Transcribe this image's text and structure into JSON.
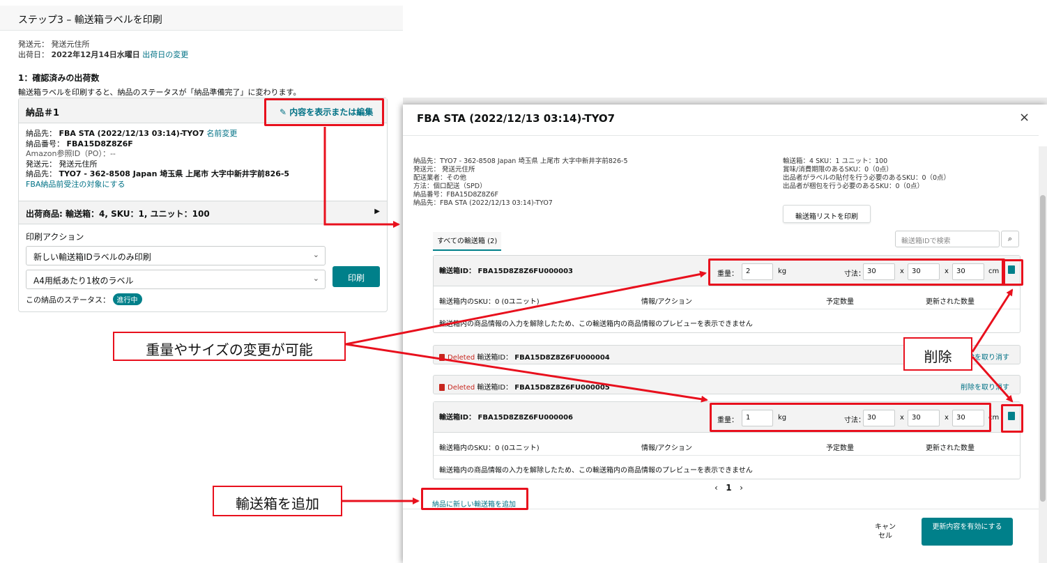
{
  "left": {
    "step_title": "ステップ3 – 輸送箱ラベルを印刷",
    "ship_from_label": "発送元：",
    "ship_from_value": "発送元住所",
    "ship_date_label": "出荷日：",
    "ship_date_value": "2022年12月14日水曜日",
    "ship_date_link": "出荷日の変更",
    "section_title": "1：確認済みの出荷数",
    "section_desc": "輸送箱ラベルを印刷すると、納品のステータスが「納品準備完了」に変わります。",
    "card": {
      "title": "納品＃1",
      "edit_link": "内容を表示または編集",
      "dest_label": "納品先：",
      "dest_value": "FBA STA (2022/12/13 03:14)-TYO7",
      "rename_link": "名前変更",
      "number_label": "納品番号：",
      "number_value": "FBA15D8Z8Z6F",
      "po_line": "Amazon参照ID（PO）：--",
      "from_label": "発送元：",
      "from_value": "発送元住所",
      "to_label": "納品先：",
      "to_value": "TYO7 - 362-8508 Japan 埼玉県 上尾市 大字中新井字前826-5",
      "prep_link": "FBA納品前受注の対象にする",
      "ship_items": "出荷商品: 輸送箱：4, SKU：1, ユニット：100",
      "print_action_label": "印刷アクション",
      "select1": "新しい輸送箱IDラベルのみ印刷",
      "select2": "A4用紙あたり1枚のラベル",
      "print_button": "印刷",
      "status_label": "この納品のステータス：",
      "status_badge": "進行中"
    }
  },
  "modal": {
    "title": "FBA STA (2022/12/13 03:14)-TYO7",
    "info_left": [
      "納品先：TYO7 - 362-8508 Japan 埼玉県 上尾市 大字中新井字前826-5",
      "発送元： 発送元住所",
      "配送業者：その他",
      "方法：個口配送（SPD）",
      "納品番号：FBA15D8Z8Z6F",
      "納品先：FBA STA (2022/12/13 03:14)-TYO7"
    ],
    "info_right": [
      "輸送箱：4  SKU：1  ユニット：100",
      "賞味/消費期限のあるSKU：0（0点）",
      "出品者がラベルの貼付を行う必要のあるSKU：0（0点）",
      "出品者が梱包を行う必要のあるSKU：0（0点）"
    ],
    "print_list_button": "輸送箱リストを印刷",
    "tab_all": "すべての輸送箱 (2)",
    "search_placeholder": "輸送箱IDで検索",
    "box1": {
      "id_label": "輸送箱ID：",
      "id": "FBA15D8Z8Z6FU000003",
      "weight_label": "重量：",
      "weight": "2",
      "weight_unit": "kg",
      "dims_label": "寸法：",
      "dim1": "30",
      "dim2": "30",
      "dim3": "30",
      "x1": "x",
      "x2": "x",
      "dims_unit": "cm"
    },
    "box2": {
      "id_label": "輸送箱ID：",
      "id": "FBA15D8Z8Z6FU000006",
      "weight_label": "重量：",
      "weight": "1",
      "weight_unit": "kg",
      "dims_label": "寸法：",
      "dim1": "30",
      "dim2": "30",
      "dim3": "30",
      "x1": "x",
      "x2": "x",
      "dims_unit": "cm"
    },
    "col_headers": [
      "輸送箱内のSKU：0 (0ユニット)",
      "情報/アクション",
      "予定数量",
      "更新された数量"
    ],
    "empty_msg": "輸送箱内の商品情報の入力を解除したため、この輸送箱内の商品情報のプレビューを表示できません",
    "deleted1": {
      "tag": "Deleted",
      "label": "輸送箱ID：",
      "id": "FBA15D8Z8Z6FU000004",
      "undo": "削除を取り消す"
    },
    "deleted2": {
      "tag": "Deleted",
      "label": "輸送箱ID：",
      "id": "FBA15D8Z8Z6FU000005",
      "undo": "削除を取り消す"
    },
    "pager": {
      "prev": "‹",
      "page": "1",
      "next": "›"
    },
    "add_box_link": "納品に新しい輸送箱を追加",
    "cancel_label": "キャンセル",
    "submit_label": "更新内容を有効にする"
  },
  "annotations": {
    "callout_resize": "重量やサイズの変更が可能",
    "callout_delete": "削除",
    "callout_add": "輸送箱を追加",
    "accent_color": "#e8101d"
  }
}
